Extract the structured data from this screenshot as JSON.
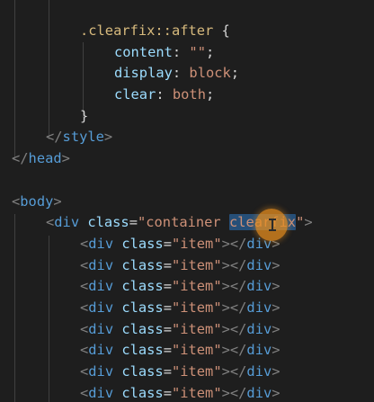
{
  "code": {
    "l1_sel": ".clearfix",
    "l1_pseudo": "::after",
    "l1_brace": " {",
    "l2_prop": "content",
    "l2_colon": ": ",
    "l2_val": "\"\"",
    "l2_semi": ";",
    "l3_prop": "display",
    "l3_colon": ": ",
    "l3_val": "block",
    "l3_semi": ";",
    "l4_prop": "clear",
    "l4_colon": ": ",
    "l4_val": "both",
    "l4_semi": ";",
    "l5_brace": "}",
    "l6_open": "</",
    "l6_tag": "style",
    "l6_close": ">",
    "l7_open": "</",
    "l7_tag": "head",
    "l7_close": ">",
    "l9_open": "<",
    "l9_tag": "body",
    "l9_close": ">",
    "l10_open": "<",
    "l10_tag": "div",
    "l10_attr": " class",
    "l10_eq": "=",
    "l10_q1": "\"",
    "l10_val1": "container ",
    "l10_val2": "clearfix",
    "l10_q2": "\"",
    "l10_close": ">",
    "item_line": {
      "open": "<",
      "tag": "div",
      "attr": " class",
      "eq": "=",
      "val": "\"item\"",
      "gt": ">",
      "end_open": "</",
      "end_tag": "div",
      "end_close": ">"
    }
  }
}
